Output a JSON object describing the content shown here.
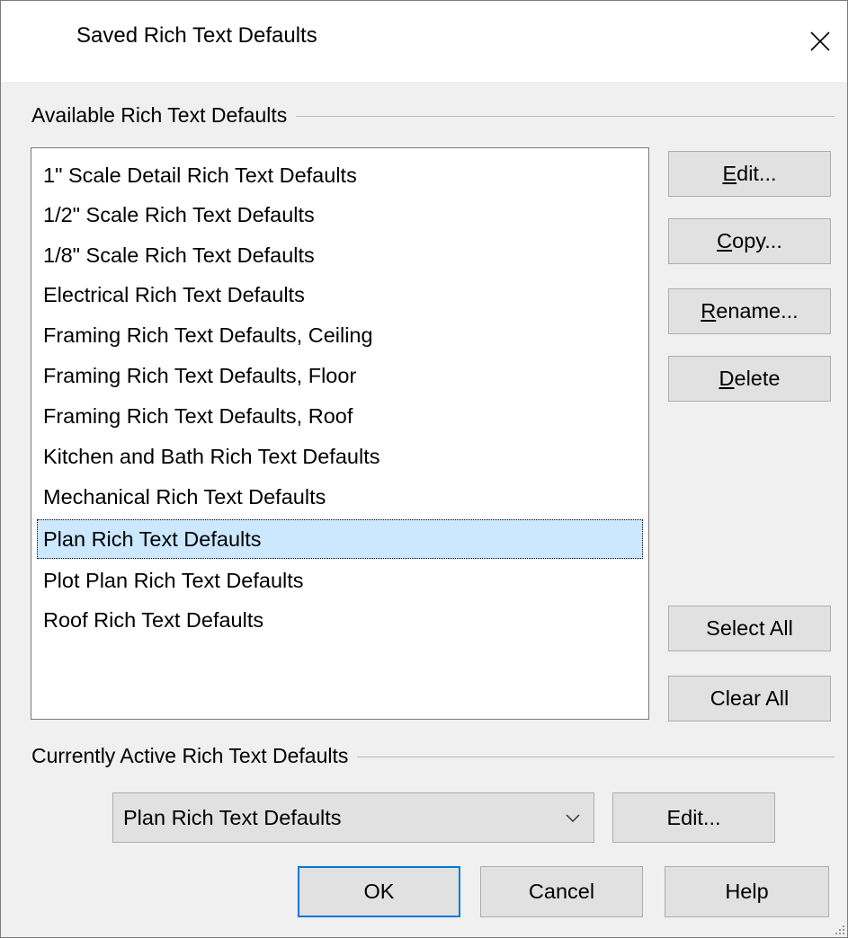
{
  "window": {
    "title": "Saved Rich Text Defaults",
    "close_icon": "close-icon"
  },
  "available_group": {
    "label": "Available Rich Text Defaults",
    "items": [
      "1\" Scale Detail Rich Text Defaults",
      "1/2\" Scale Rich Text Defaults",
      "1/8\" Scale Rich Text Defaults",
      "Electrical Rich Text Defaults",
      "Framing Rich Text Defaults, Ceiling",
      "Framing Rich Text Defaults, Floor",
      "Framing Rich Text Defaults, Roof",
      "Kitchen and Bath Rich Text Defaults",
      "Mechanical Rich Text Defaults",
      "Plan Rich Text Defaults",
      "Plot Plan Rich Text Defaults",
      "Roof Rich Text Defaults"
    ],
    "selected_index": 9
  },
  "side_buttons": {
    "edit": "Edit...",
    "copy": "Copy...",
    "rename": "Rename...",
    "delete": "Delete",
    "select_all": "Select All",
    "clear_all": "Clear All"
  },
  "active_group": {
    "label": "Currently Active Rich Text Defaults",
    "selected_value": "Plan Rich Text Defaults",
    "edit_label": "Edit..."
  },
  "footer": {
    "ok": "OK",
    "cancel": "Cancel",
    "help": "Help"
  },
  "colors": {
    "selection": "#cce8ff",
    "default_button_border": "#0078d7",
    "button_face": "#e1e1e1",
    "dialog_face": "#f0f0f0"
  }
}
